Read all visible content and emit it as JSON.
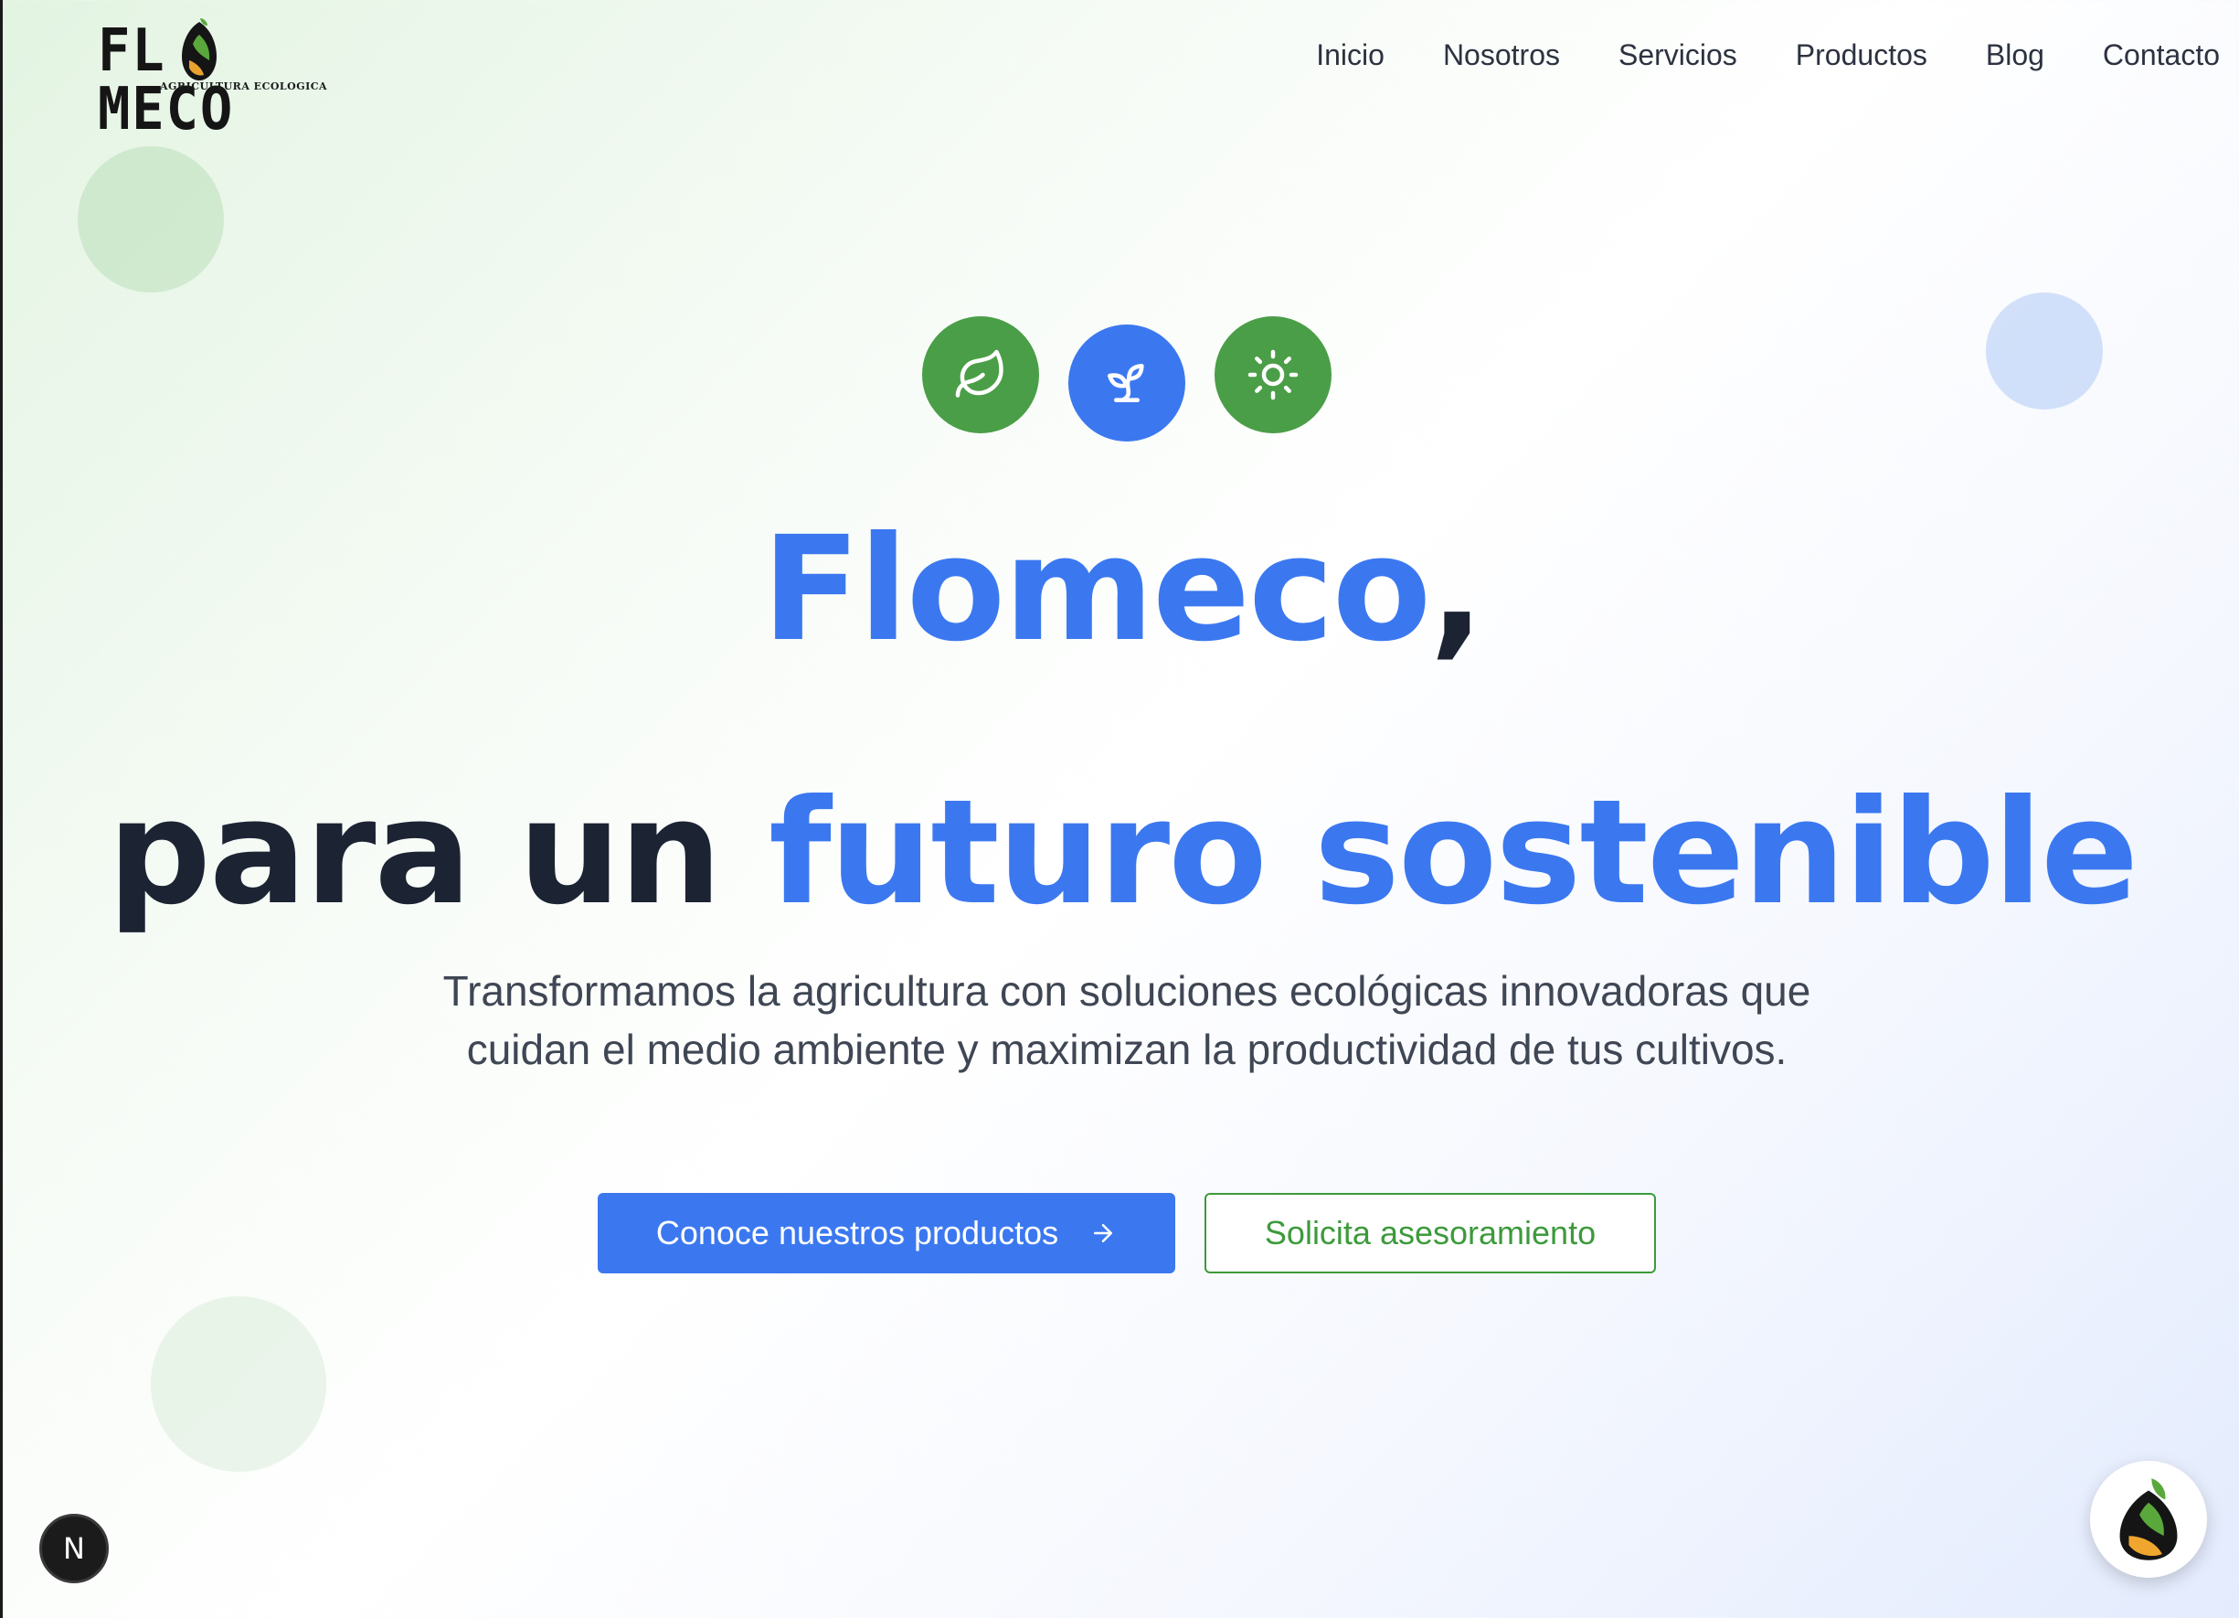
{
  "brand": {
    "logo_text_left": "FL",
    "logo_text_right": "MECO",
    "tagline": "AGRICULTURA ECOLOGICA",
    "colors": {
      "blue": "#3b78f0",
      "green": "#4a9e47",
      "dark": "#1c2333"
    }
  },
  "nav": {
    "items": [
      {
        "label": "Inicio"
      },
      {
        "label": "Nosotros"
      },
      {
        "label": "Servicios"
      },
      {
        "label": "Productos"
      },
      {
        "label": "Blog"
      },
      {
        "label": "Contacto"
      }
    ]
  },
  "hero": {
    "icons": [
      "leaf-icon",
      "sprout-icon",
      "sun-icon"
    ],
    "title_brand": "Flomeco",
    "title_comma": ",",
    "title_line2_dark": "para un ",
    "title_line2_blue": "futuro sostenible",
    "subtitle": "Transformamos la agricultura con soluciones ecológicas innovadoras que cuidan el medio ambiente y maximizan la productividad de tus cultivos.",
    "primary_button": "Conoce nuestros productos",
    "secondary_button": "Solicita asesoramiento"
  },
  "floating": {
    "dev_badge": "N",
    "chat_icon": "flomeco-mascot-icon"
  }
}
